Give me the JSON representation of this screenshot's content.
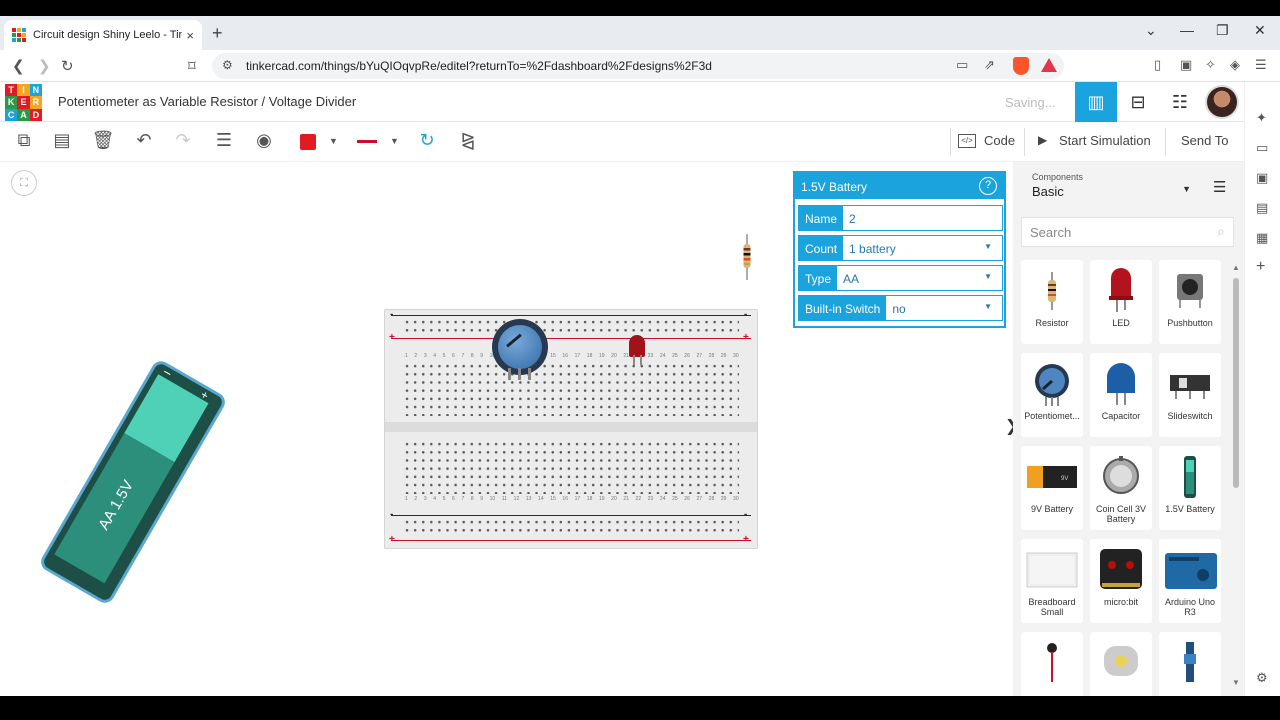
{
  "browser": {
    "tab_title": "Circuit design Shiny Leelo - Tinkercad",
    "tab_close": "×",
    "new_tab": "+",
    "url": "tinkercad.com/things/bYuQIOqvpRe/editel?returnTo=%2Fdashboard%2Fdesigns%2F3d"
  },
  "app": {
    "logo_letters": [
      "T",
      "I",
      "N",
      "K",
      "E",
      "R",
      "C",
      "A",
      "D"
    ],
    "logo_colors": [
      "#e21b22",
      "#f4a623",
      "#1aa3dd",
      "#2b9a47",
      "#e21b22",
      "#f4a623",
      "#1aa3dd",
      "#2b9a47",
      "#e21b22"
    ],
    "title": "Potentiometer as Variable Resistor / Voltage Divider",
    "status": "Saving...",
    "accent": "#1aa3dd"
  },
  "toolbar": {
    "code_label": "Code",
    "start_sim_label": "Start Simulation",
    "send_to_label": "Send To",
    "wire_color": "#e21b22"
  },
  "canvas": {
    "battery_label": "AA 1.5V",
    "battery_plus": "+",
    "battery_minus": "−",
    "rail_plus": "+",
    "rail_minus": "-"
  },
  "inspector": {
    "title": "1.5V Battery",
    "help": "?",
    "rows": [
      {
        "key": "Name",
        "value": "2"
      },
      {
        "key": "Count",
        "value": "1 battery"
      },
      {
        "key": "Type",
        "value": "AA"
      },
      {
        "key": "Built-in Switch",
        "value": "no"
      }
    ]
  },
  "components": {
    "selector_label": "Components",
    "selector_value": "Basic",
    "search_placeholder": "Search",
    "items": [
      {
        "name": "Resistor"
      },
      {
        "name": "LED"
      },
      {
        "name": "Pushbutton"
      },
      {
        "name": "Potentiomet..."
      },
      {
        "name": "Capacitor"
      },
      {
        "name": "Slideswitch"
      },
      {
        "name": "9V Battery"
      },
      {
        "name": "Coin Cell 3V Battery"
      },
      {
        "name": "1.5V Battery"
      },
      {
        "name": "Breadboard Small"
      },
      {
        "name": "micro:bit"
      },
      {
        "name": "Arduino Uno R3"
      }
    ]
  }
}
